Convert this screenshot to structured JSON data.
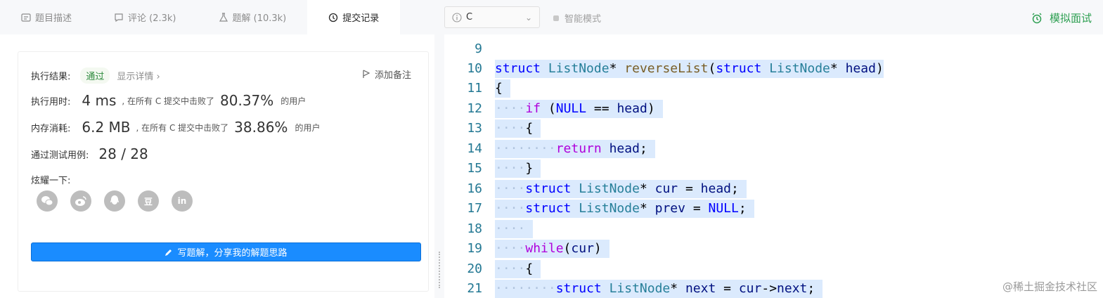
{
  "tabs": [
    {
      "icon": "description-icon",
      "label": "题目描述"
    },
    {
      "icon": "comment-icon",
      "label": "评论 (2.3k)"
    },
    {
      "icon": "flask-icon",
      "label": "题解 (10.3k)"
    },
    {
      "icon": "clock-icon",
      "label": "提交记录"
    }
  ],
  "result": {
    "label": "执行结果:",
    "status": "通过",
    "details": "显示详情 ›",
    "add_note": "添加备注",
    "time_label": "执行用时:",
    "time_value": "4 ms",
    "time_text": ", 在所有 C 提交中击败了",
    "time_pct": "80.37%",
    "users": "的用户",
    "mem_label": "内存消耗:",
    "mem_value": "6.2 MB",
    "mem_text": ", 在所有 C 提交中击败了",
    "mem_pct": "38.86%",
    "tests_label": "通过测试用例:",
    "tests_value": "28 / 28",
    "share_label": "炫耀一下:",
    "share_icons": [
      "wechat-icon",
      "weibo-icon",
      "qq-icon",
      "douban-icon",
      "linkedin-icon"
    ],
    "douban_glyph": "豆",
    "linkedin_glyph": "in",
    "write_button": "写题解，分享我的解题思路"
  },
  "editor_bar": {
    "language": "C",
    "mode": "智能模式",
    "mock": "模拟面试"
  },
  "code_lines": [
    {
      "n": "9",
      "text": ""
    },
    {
      "n": "10",
      "text": "struct ListNode* reverseList(struct ListNode* head)"
    },
    {
      "n": "11",
      "text": "{"
    },
    {
      "n": "12",
      "text": "    if (NULL == head)"
    },
    {
      "n": "13",
      "text": "    {"
    },
    {
      "n": "14",
      "text": "        return head;"
    },
    {
      "n": "15",
      "text": "    }"
    },
    {
      "n": "16",
      "text": "    struct ListNode* cur = head;"
    },
    {
      "n": "17",
      "text": "    struct ListNode* prev = NULL;"
    },
    {
      "n": "18",
      "text": "    "
    },
    {
      "n": "19",
      "text": "    while(cur)"
    },
    {
      "n": "20",
      "text": "    {"
    },
    {
      "n": "21",
      "text": "        struct ListNode* next = cur->next;"
    }
  ],
  "watermark": "@稀土掘金技术社区",
  "colors": {
    "accent": "#1a8cff",
    "success": "#2e8b3e",
    "mock": "#2e9f52",
    "highlight": "#dbeafd"
  }
}
